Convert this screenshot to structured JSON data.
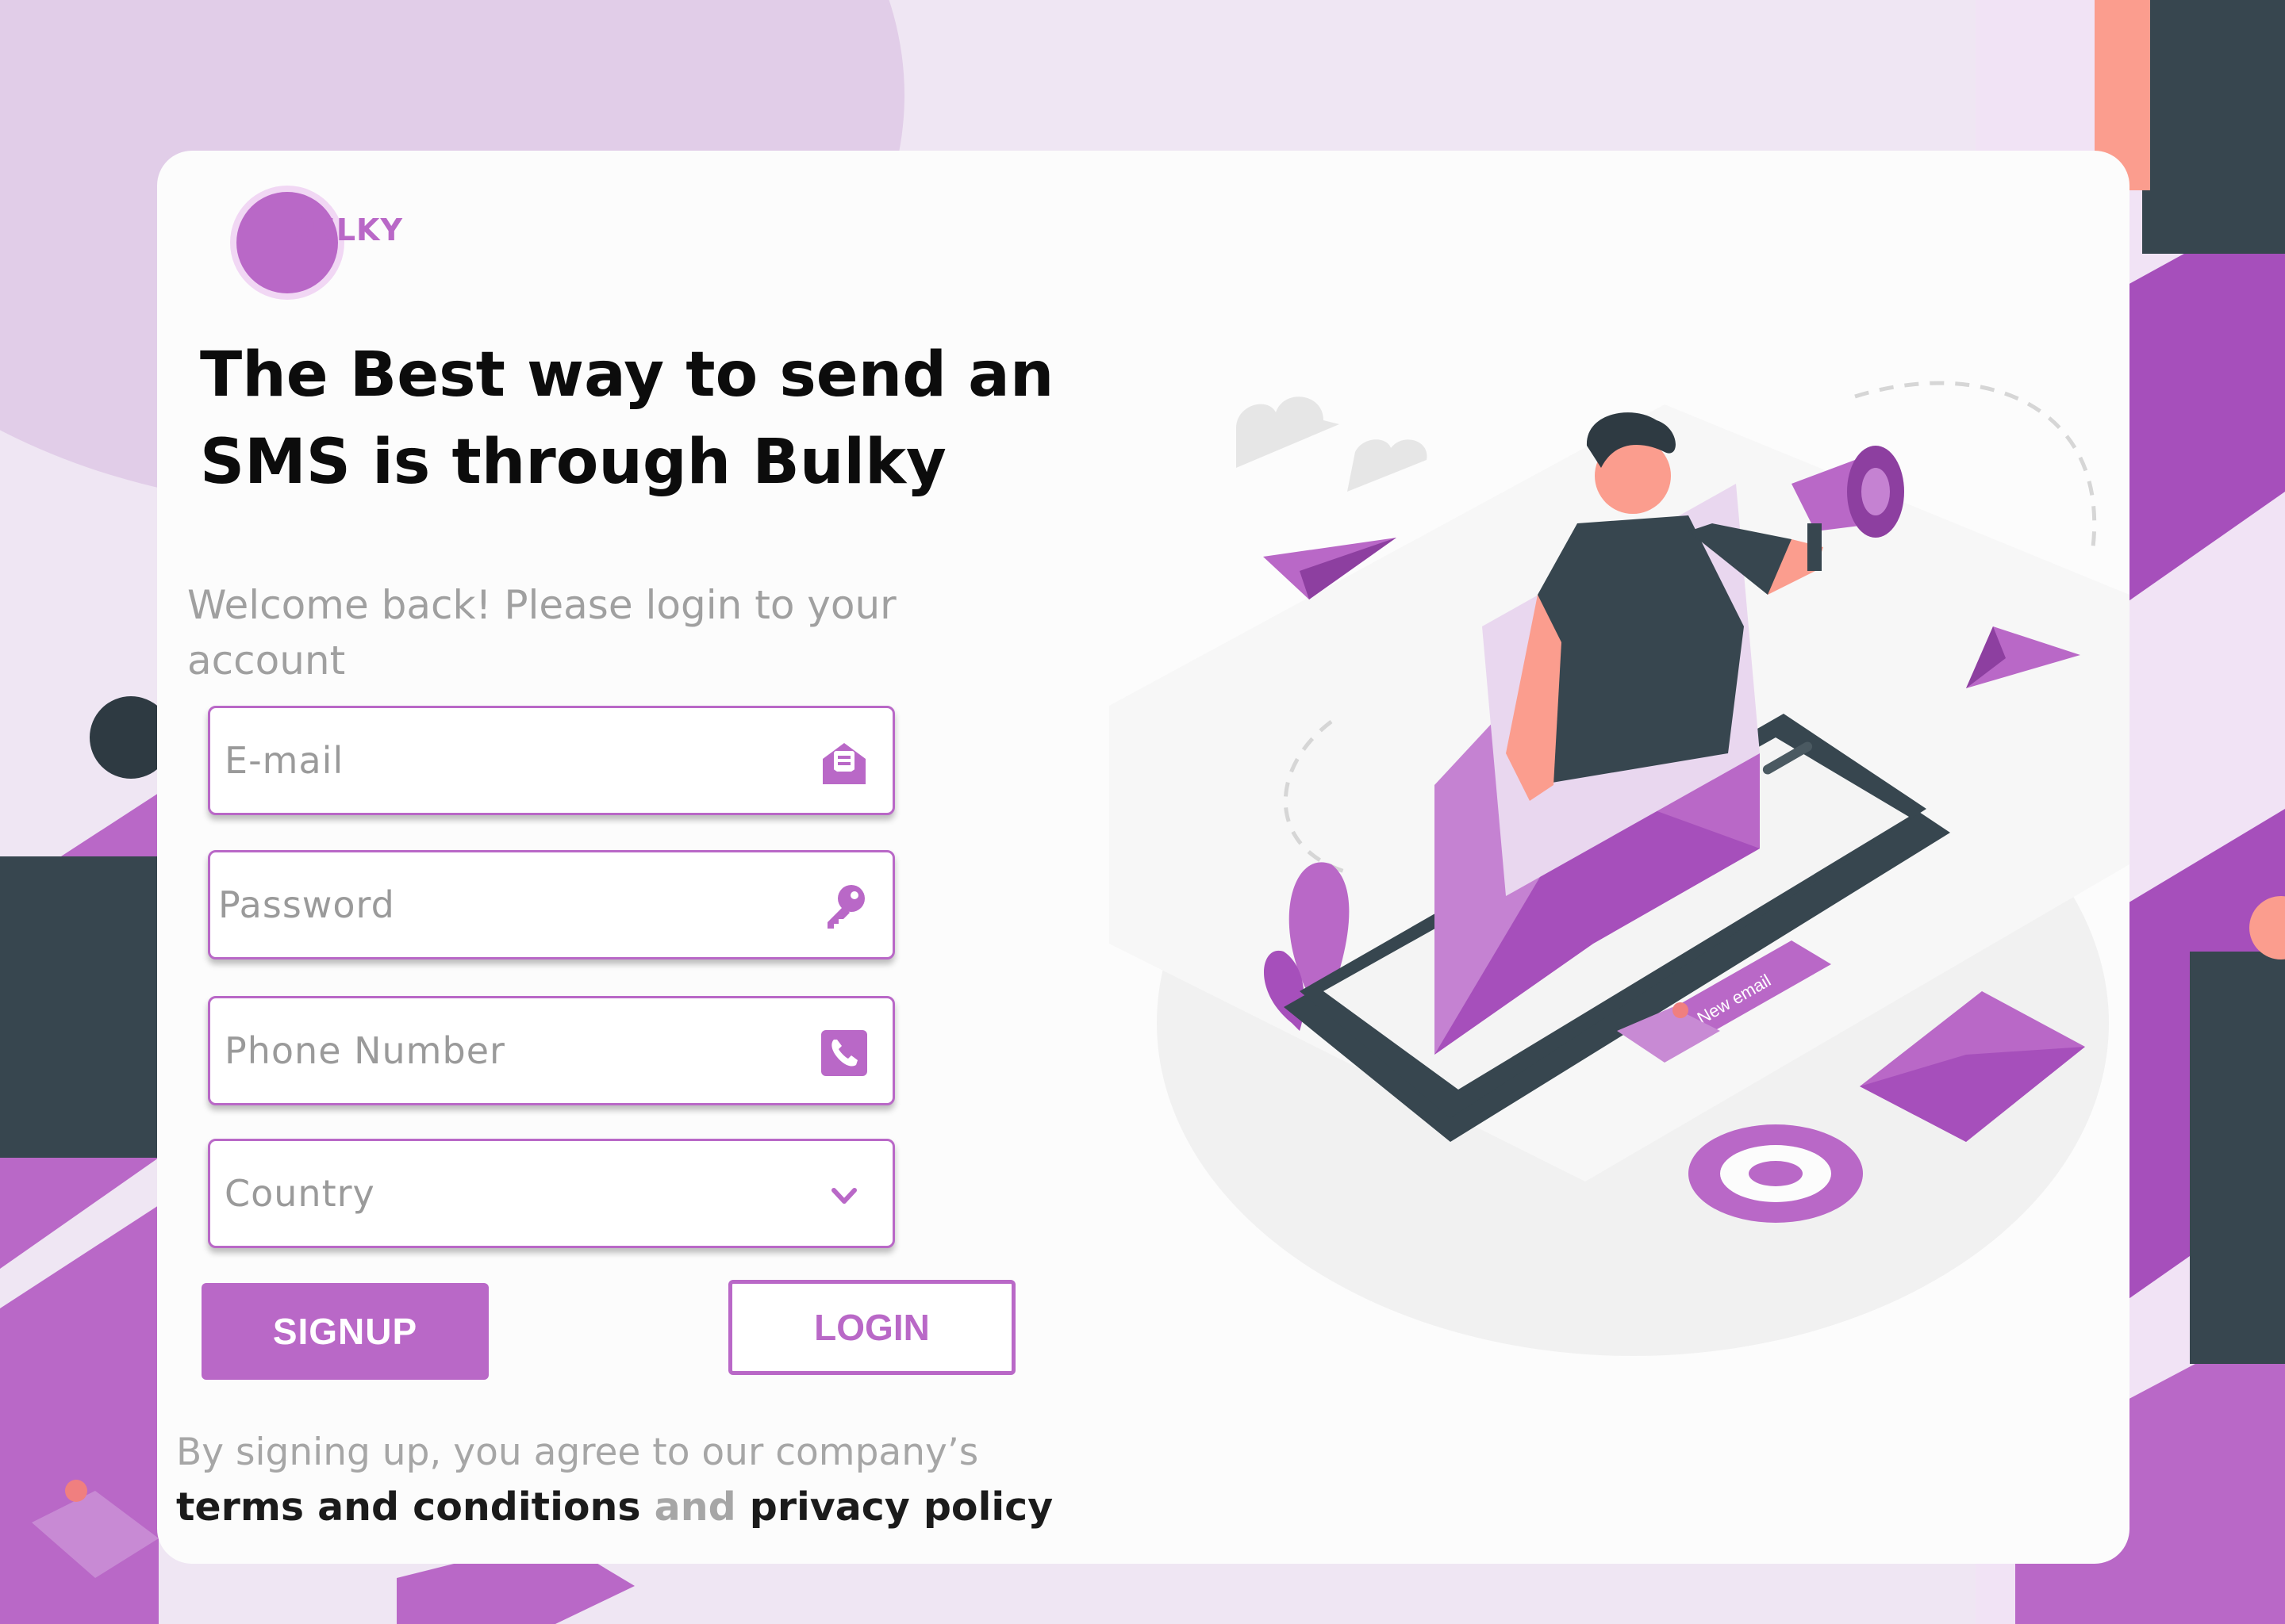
{
  "brand": {
    "logo_text": "BULKY"
  },
  "headline": {
    "line1": "The Best way to send an",
    "line2": "SMS is through Bulky"
  },
  "welcome": "Welcome back! Please login to your account",
  "form": {
    "email_placeholder": "E-mail",
    "password_placeholder": "Password",
    "phone_placeholder": "Phone Number",
    "country_placeholder": "Country"
  },
  "buttons": {
    "signup": "SIGNUP",
    "login": "LOGIN"
  },
  "terms": {
    "prefix": "By signing up, you agree to our company’s",
    "terms_link": "terms and conditions",
    "and": " and ",
    "privacy_link": "privacy policy"
  },
  "illustration": {
    "tag_text": "New email"
  },
  "icons": {
    "email": "email-envelope-icon",
    "password": "key-icon",
    "phone": "phone-icon",
    "country": "chevron-down-icon"
  },
  "colors": {
    "accent": "#b968c7",
    "dark": "#37464f",
    "skin": "#fb9d8e"
  }
}
